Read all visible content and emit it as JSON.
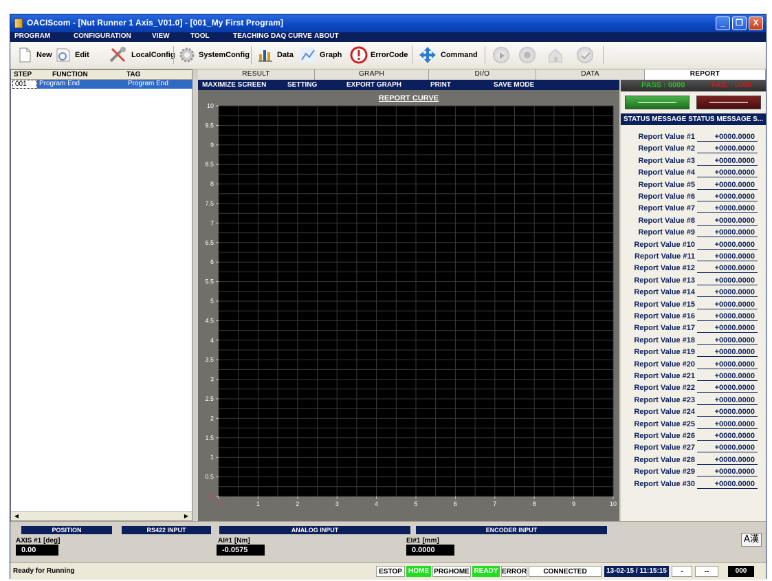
{
  "window": {
    "title": "OACIScom - [Nut Runner 1 Axis_V01.0] - [001_My First Program]",
    "buttons": [
      "_",
      "❐",
      "X"
    ]
  },
  "menu": [
    "PROGRAM",
    "CONFIGURATION",
    "VIEW",
    "TOOL",
    "TEACHING DAQ CURVE",
    "ABOUT"
  ],
  "toolbar": {
    "new": "New",
    "edit": "Edit",
    "local_config": "LocalConfig",
    "system_config": "SystemConfig",
    "data": "Data",
    "graph": "Graph",
    "error_code": "ErrorCode",
    "command": "Command",
    "icons": [
      "new-icon",
      "edit-icon",
      "wrench-icon",
      "gear-icon",
      "bar-chart-icon",
      "line-chart-icon",
      "warning-icon",
      "move-arrows-icon",
      "play-icon",
      "stop-icon",
      "home-icon",
      "check-icon"
    ]
  },
  "program_table": {
    "headers": [
      "STEP",
      "FUNCTION",
      "TAG"
    ],
    "rows": [
      {
        "step": "001",
        "function": "Program End",
        "tag": "Program End"
      }
    ]
  },
  "tabs": [
    "RESULT",
    "GRAPH",
    "DI/O",
    "DATA",
    "REPORT"
  ],
  "active_tab": "REPORT",
  "graph_toolbar": [
    "MAXIMIZE SCREEN",
    "SETTING",
    "EXPORT GRAPH",
    "PRINT",
    "SAVE MODE"
  ],
  "chart_data": {
    "type": "line",
    "title": "REPORT CURVE",
    "xlim": [
      0,
      10
    ],
    "ylim": [
      0,
      10
    ],
    "x_ticks": [
      "0",
      "1",
      "2",
      "3",
      "4",
      "5",
      "6",
      "7",
      "8",
      "9",
      "10"
    ],
    "y_ticks": [
      "0",
      "0.5",
      "1",
      "1.5",
      "2",
      "2.5",
      "3",
      "3.5",
      "4",
      "4.5",
      "5",
      "5.5",
      "6",
      "6.5",
      "7",
      "7.5",
      "8",
      "8.5",
      "9",
      "9.5",
      "10"
    ],
    "grid": true,
    "series": [],
    "background": "#000000",
    "grid_color": "#3a3a3a"
  },
  "report": {
    "pass": "PASS : 0000",
    "fail": "FAIL : 0000",
    "status_message": "STATUS MESSAGE STATUS MESSAGE S...",
    "values": [
      {
        "label": "Report Value #1",
        "value": "+0000.0000"
      },
      {
        "label": "Report Value #2",
        "value": "+0000.0000"
      },
      {
        "label": "Report Value #3",
        "value": "+0000.0000"
      },
      {
        "label": "Report Value #4",
        "value": "+0000.0000"
      },
      {
        "label": "Report Value #5",
        "value": "+0000.0000"
      },
      {
        "label": "Report Value #6",
        "value": "+0000.0000"
      },
      {
        "label": "Report Value #7",
        "value": "+0000.0000"
      },
      {
        "label": "Report Value #8",
        "value": "+0000.0000"
      },
      {
        "label": "Report Value #9",
        "value": "+0000.0000"
      },
      {
        "label": "Report Value #10",
        "value": "+0000.0000"
      },
      {
        "label": "Report Value #11",
        "value": "+0000.0000"
      },
      {
        "label": "Report Value #12",
        "value": "+0000.0000"
      },
      {
        "label": "Report Value #13",
        "value": "+0000.0000"
      },
      {
        "label": "Report Value #14",
        "value": "+0000.0000"
      },
      {
        "label": "Report Value #15",
        "value": "+0000.0000"
      },
      {
        "label": "Report Value #16",
        "value": "+0000.0000"
      },
      {
        "label": "Report Value #17",
        "value": "+0000.0000"
      },
      {
        "label": "Report Value #18",
        "value": "+0000.0000"
      },
      {
        "label": "Report Value #19",
        "value": "+0000.0000"
      },
      {
        "label": "Report Value #20",
        "value": "+0000.0000"
      },
      {
        "label": "Report Value #21",
        "value": "+0000.0000"
      },
      {
        "label": "Report Value #22",
        "value": "+0000.0000"
      },
      {
        "label": "Report Value #23",
        "value": "+0000.0000"
      },
      {
        "label": "Report Value #24",
        "value": "+0000.0000"
      },
      {
        "label": "Report Value #25",
        "value": "+0000.0000"
      },
      {
        "label": "Report Value #26",
        "value": "+0000.0000"
      },
      {
        "label": "Report Value #27",
        "value": "+0000.0000"
      },
      {
        "label": "Report Value #28",
        "value": "+0000.0000"
      },
      {
        "label": "Report Value #29",
        "value": "+0000.0000"
      },
      {
        "label": "Report Value #30",
        "value": "+0000.0000"
      }
    ]
  },
  "io": {
    "position": {
      "header": "POSITION",
      "label": "AXIS #1 [deg]",
      "value": "0.00"
    },
    "rs422": {
      "header": "RS422 INPUT"
    },
    "analog": {
      "header": "ANALOG INPUT",
      "label": "AI#1 [Nm]",
      "value": "-0.0575"
    },
    "encoder": {
      "header": "ENCODER INPUT",
      "label": "EI#1 [mm]",
      "value": "0.0000"
    },
    "ime": "A漢"
  },
  "status_bar": {
    "message": "Ready for Running",
    "estop": "ESTOP",
    "home": "HOME",
    "prghome": "PRGHOME",
    "ready": "READY",
    "error": "ERROR",
    "connection": "CONNECTED",
    "datetime": "13-02-15 / 11:15:15",
    "field1": "-",
    "field2": "--",
    "counter": "000"
  },
  "colors": {
    "accent_navy": "#0b1f5c",
    "selection_blue": "#316ac5",
    "status_green": "#22dd22",
    "highlight_red": "#e00000"
  }
}
